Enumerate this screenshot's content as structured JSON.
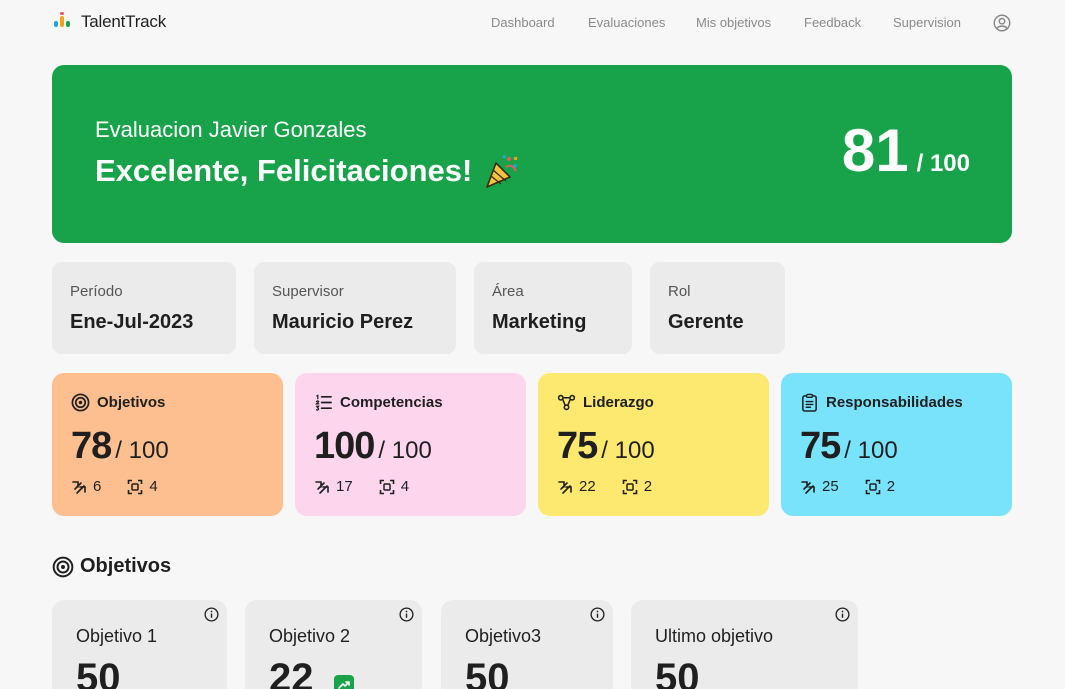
{
  "nav": {
    "brand": "TalentTrack",
    "links": [
      "Dashboard",
      "Evaluaciones",
      "Mis objetivos",
      "Feedback",
      "Supervision"
    ],
    "user_icon": "user-circle-icon"
  },
  "hero": {
    "subtitle": "Evaluacion Javier Gonzales",
    "title": "Excelente, Felicitaciones!",
    "title_icon": "party-popper-icon",
    "score": "81",
    "score_max": "/ 100",
    "color": "#18a34a"
  },
  "info": [
    {
      "label": "Período",
      "value": "Ene-Jul-2023"
    },
    {
      "label": "Supervisor",
      "value": "Mauricio Perez"
    },
    {
      "label": "Área",
      "value": "Marketing"
    },
    {
      "label": "Rol",
      "value": "Gerente"
    }
  ],
  "scores": [
    {
      "title": "Objetivos",
      "icon": "target-icon",
      "value": "78",
      "max": "/ 100",
      "stat_a": "6",
      "stat_b": "4",
      "color": "#fdbf8f"
    },
    {
      "title": "Competencias",
      "icon": "list-icon",
      "value": "100",
      "max": "/ 100",
      "stat_a": "17",
      "stat_b": "4",
      "color": "#fdd6ee"
    },
    {
      "title": "Liderazgo",
      "icon": "network-icon",
      "value": "75",
      "max": "/ 100",
      "stat_a": "22",
      "stat_b": "2",
      "color": "#fde870"
    },
    {
      "title": "Responsabilidades",
      "icon": "clipboard-icon",
      "value": "75",
      "max": "/ 100",
      "stat_a": "25",
      "stat_b": "2",
      "color": "#79e3fc"
    }
  ],
  "section": {
    "title": "Objetivos",
    "icon": "target-icon"
  },
  "objectives": [
    {
      "title": "Objetivo 1",
      "value": "50"
    },
    {
      "title": "Objetivo 2",
      "value": "22",
      "badge_icon": "trend-up-icon"
    },
    {
      "title": "Objetivo3",
      "value": "50"
    },
    {
      "title": "Ultimo objetivo",
      "value": "50"
    }
  ]
}
